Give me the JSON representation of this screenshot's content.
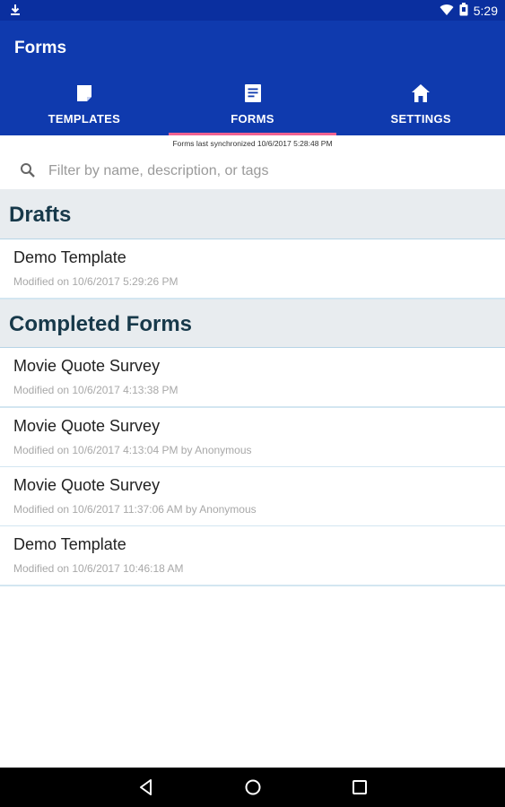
{
  "status_bar": {
    "time": "5:29",
    "download_icon": "download-icon",
    "wifi_icon": "wifi-icon",
    "battery_icon": "battery-icon"
  },
  "app_bar": {
    "title": "Forms"
  },
  "tabs": [
    {
      "label": "TEMPLATES",
      "icon": "template-icon",
      "active": false
    },
    {
      "label": "FORMS",
      "icon": "form-icon",
      "active": true
    },
    {
      "label": "SETTINGS",
      "icon": "home-icon",
      "active": false
    }
  ],
  "sync_text": "Forms last synchronized 10/6/2017 5:28:48 PM",
  "search": {
    "placeholder": "Filter by name, description, or tags",
    "value": ""
  },
  "drafts": {
    "heading": "Drafts",
    "items": [
      {
        "title": "Demo Template",
        "meta": "Modified on 10/6/2017 5:29:26 PM"
      }
    ]
  },
  "completed": {
    "heading": "Completed Forms",
    "items": [
      {
        "title": "Movie Quote Survey",
        "meta": "Modified on 10/6/2017 4:13:38 PM"
      },
      {
        "title": "Movie Quote Survey",
        "meta": "Modified on 10/6/2017 4:13:04 PM by Anonymous"
      },
      {
        "title": "Movie Quote Survey",
        "meta": "Modified on 10/6/2017 11:37:06 AM by Anonymous"
      },
      {
        "title": "Demo Template",
        "meta": "Modified on 10/6/2017 10:46:18 AM"
      }
    ]
  },
  "nav_bar": {
    "back_icon": "back-icon",
    "home_icon": "home-circle-icon",
    "recents_icon": "recents-icon"
  },
  "colors": {
    "status_bar": "#0a2f9f",
    "app_bar": "#0f3aae",
    "tab_indicator": "#f06292",
    "section_bg": "#e8ecef",
    "section_text": "#17394a",
    "divider": "#d3e6f1"
  }
}
